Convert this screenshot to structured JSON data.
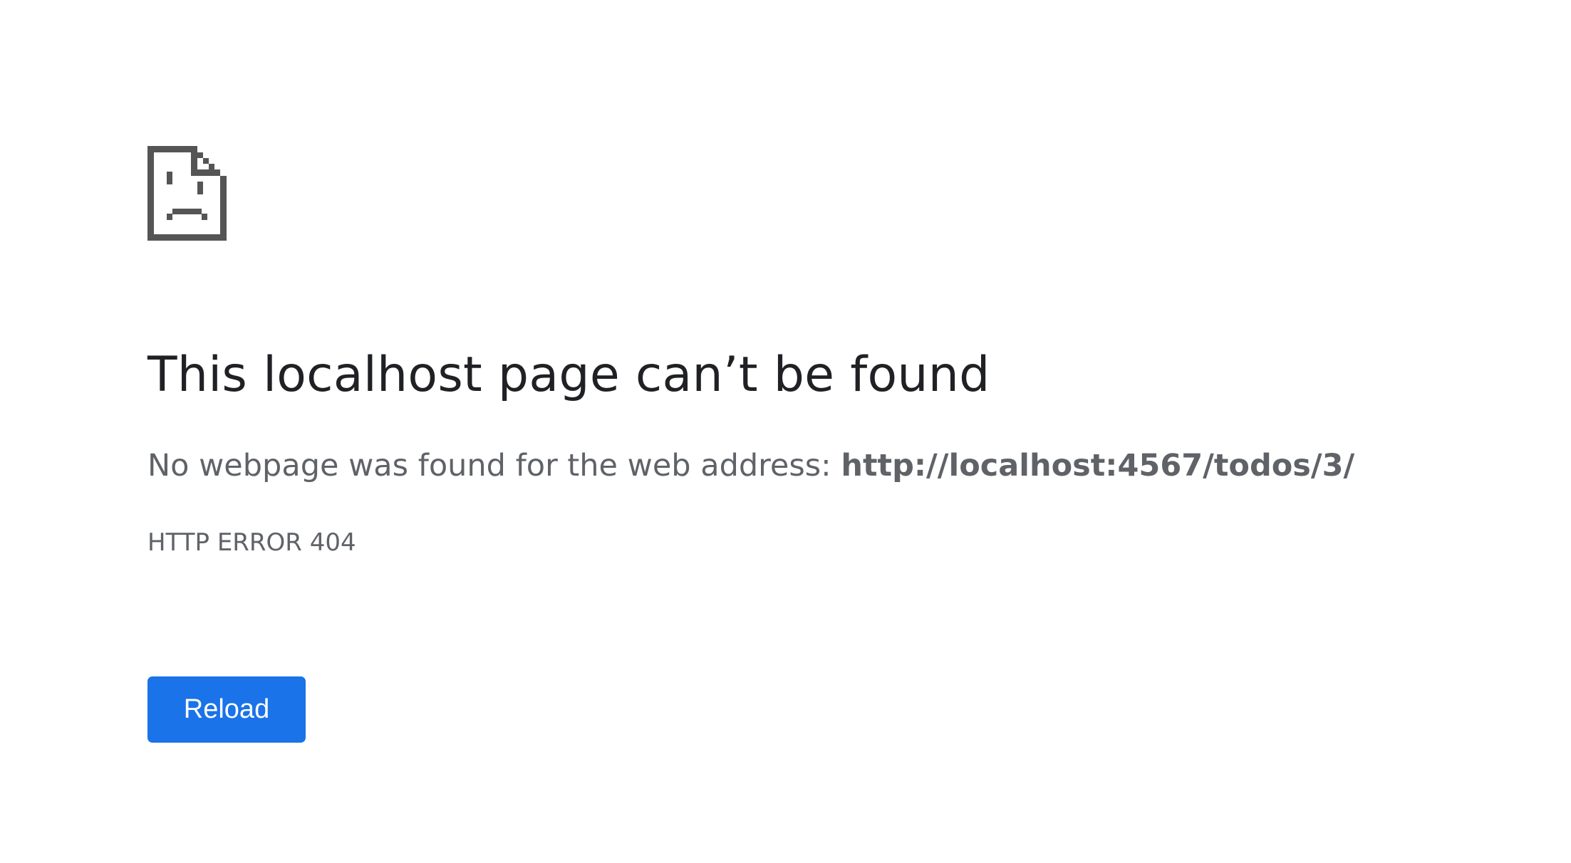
{
  "error_page": {
    "icon": "sad-document-icon",
    "title": "This localhost page can’t be found",
    "message_prefix": "No webpage was found for the web address: ",
    "url": "http://localhost:4567/todos/3/",
    "error_code": "HTTP ERROR 404",
    "reload_label": "Reload"
  },
  "colors": {
    "title": "#202124",
    "secondary_text": "#5f6368",
    "button_background": "#1a73e8",
    "button_text": "#ffffff",
    "icon": "#555555"
  }
}
